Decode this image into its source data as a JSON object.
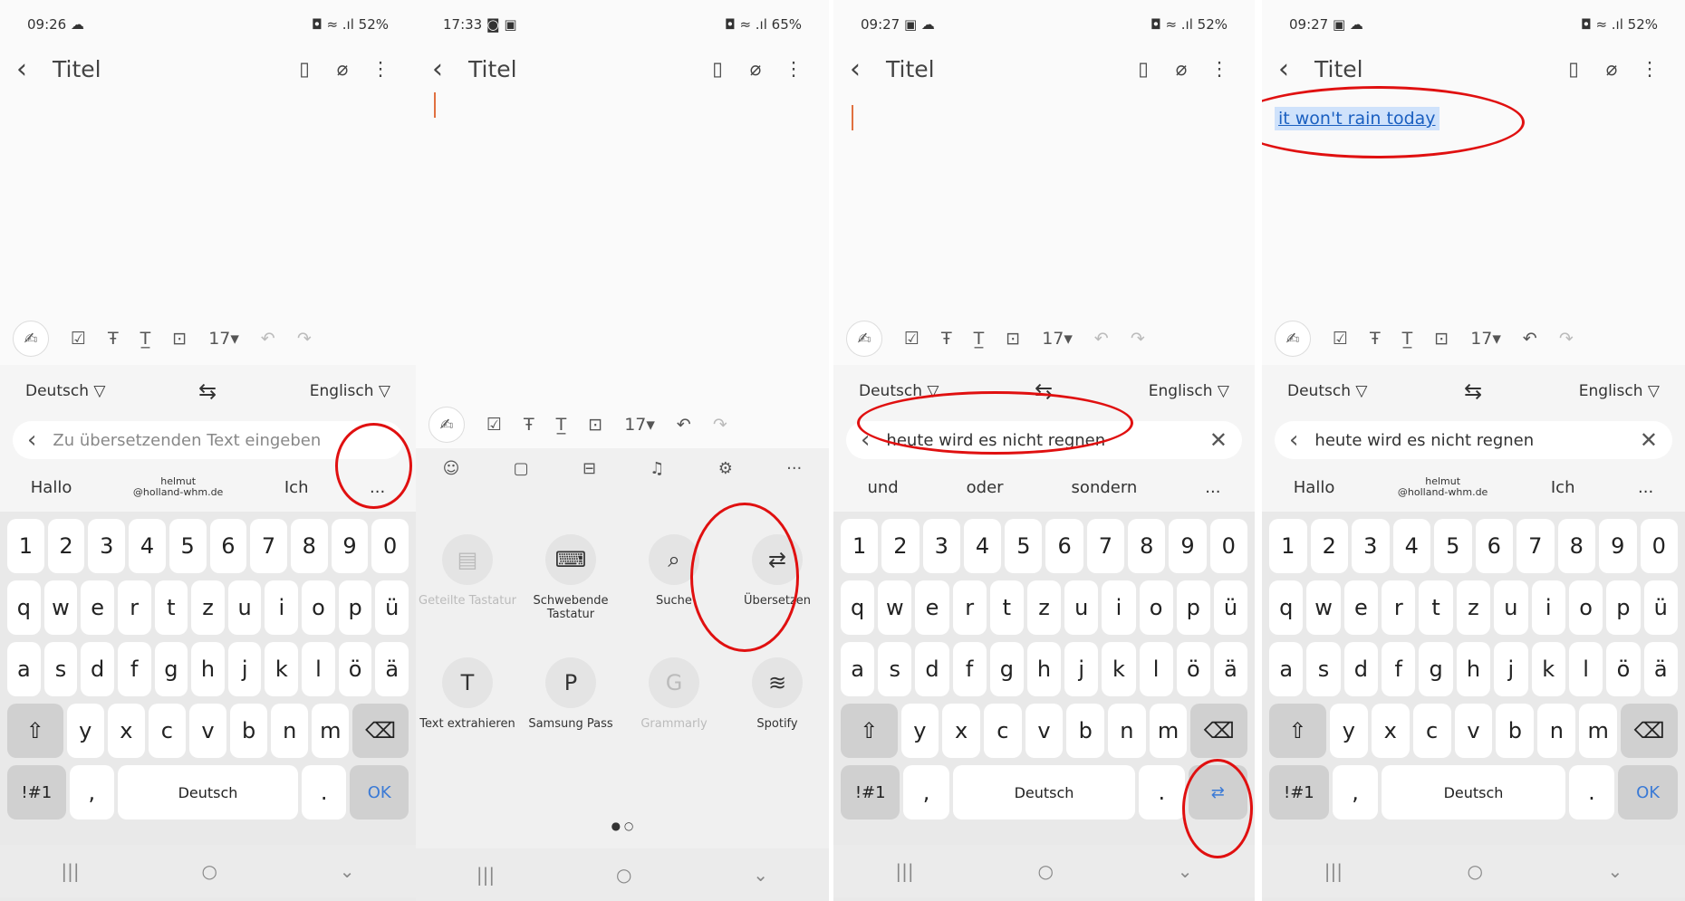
{
  "panels": [
    {
      "time": "09:26 ☁",
      "status_right": "◘ ≈ .ıl 52%",
      "title": "Titel",
      "toolbar_size": "17▾",
      "lang_from": "Deutsch ▽",
      "lang_to": "Englisch ▽",
      "input_placeholder": "Zu übersetzenden Text eingeben",
      "suggestions": [
        "Hallo",
        "helmut",
        "@holland-whm.de",
        "Ich",
        "..."
      ],
      "space": "Deutsch",
      "ok": "OK"
    },
    {
      "time": "17:33 ◙ ▣",
      "status_right": "◘ ≈ .ıl 65%",
      "title": "Titel",
      "toolbar_size": "17▾",
      "menu_items": [
        "Geteilte Tastatur",
        "Schwebende Tastatur",
        "Suche",
        "Übersetzen",
        "Text extrahieren",
        "Samsung Pass",
        "Grammarly",
        "Spotify"
      ],
      "page_dots": "● ○"
    },
    {
      "time": "09:27 ▣ ☁",
      "status_right": "◘ ≈ .ıl 52%",
      "title": "Titel",
      "toolbar_size": "17▾",
      "lang_from": "Deutsch ▽",
      "lang_to": "Englisch ▽",
      "input_text": "heute wird es nicht regnen",
      "suggestions": [
        "und",
        "oder",
        "sondern",
        "..."
      ],
      "space": "Deutsch"
    },
    {
      "time": "09:27 ▣ ☁",
      "status_right": "◘ ≈ .ıl 52%",
      "title": "Titel",
      "translated": "it won't rain today",
      "toolbar_size": "17▾",
      "lang_from": "Deutsch ▽",
      "lang_to": "Englisch ▽",
      "input_text": "heute wird es nicht regnen",
      "suggestions": [
        "Hallo",
        "helmut",
        "@holland-whm.de",
        "Ich",
        "..."
      ],
      "space": "Deutsch",
      "ok": "OK"
    }
  ],
  "keys": {
    "numbers": [
      "1",
      "2",
      "3",
      "4",
      "5",
      "6",
      "7",
      "8",
      "9",
      "0"
    ],
    "row1": [
      "q",
      "w",
      "e",
      "r",
      "t",
      "z",
      "u",
      "i",
      "o",
      "p",
      "ü"
    ],
    "row2": [
      "a",
      "s",
      "d",
      "f",
      "g",
      "h",
      "j",
      "k",
      "l",
      "ö",
      "ä"
    ],
    "row3": [
      "y",
      "x",
      "c",
      "v",
      "b",
      "n",
      "m"
    ],
    "sym": "!#1",
    "comma": ",",
    "period": "."
  },
  "icons": {
    "back": "‹",
    "book": "▯",
    "clip": "⌀",
    "more": "⋮",
    "shift": "⇧",
    "backspace": "⌫"
  },
  "highlight_color": "#e01010"
}
